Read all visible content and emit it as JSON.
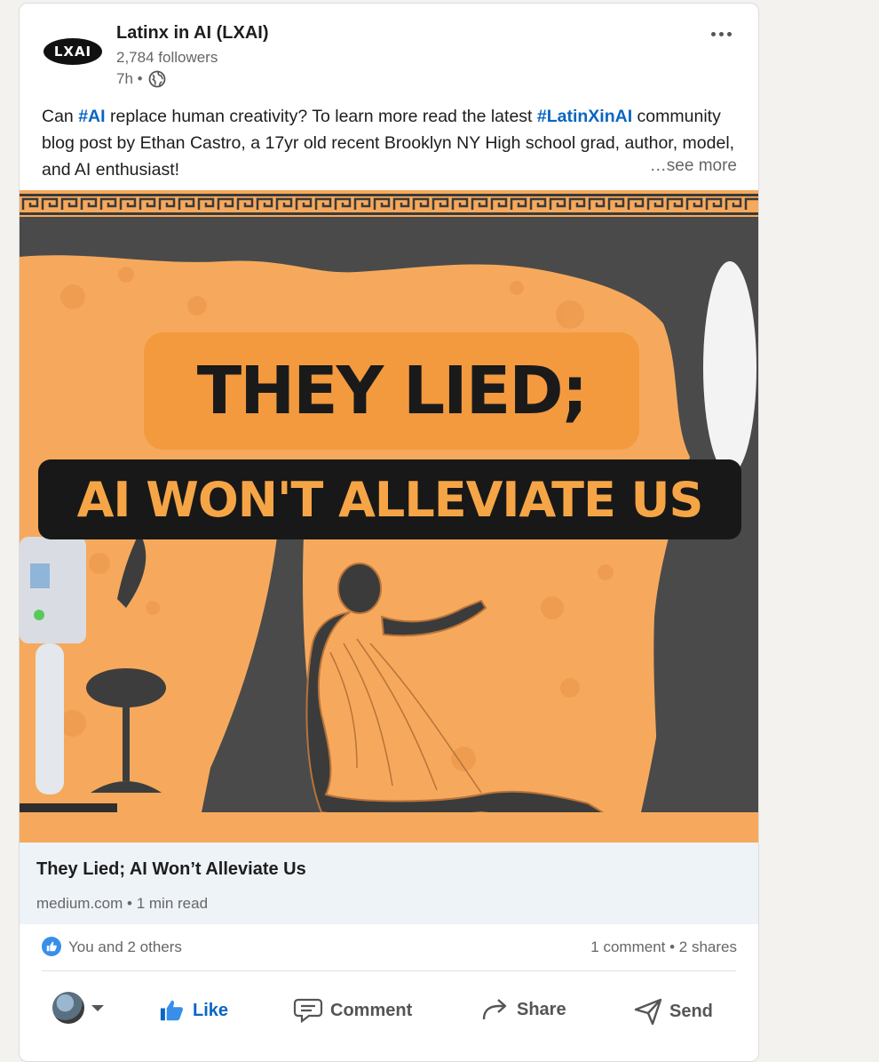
{
  "colors": {
    "link_blue": "#0a66c2",
    "image_orange": "#f6a95c",
    "headline_orange": "#f39a3f",
    "headline_dark": "#181818",
    "preview_bg": "#eef3f8"
  },
  "header": {
    "logo_text": "LXAI",
    "company_name": "Latinx in AI (LXAI)",
    "followers": "2,784 followers",
    "time": "7h •",
    "visibility_icon": "globe-icon",
    "more_icon": "ellipsis-icon"
  },
  "post": {
    "text_1": "Can ",
    "hashtag_1": "#AI",
    "text_2": " replace human creativity? To learn more read the latest ",
    "hashtag_2": "#LatinXinAI",
    "text_3": " community blog post by Ethan Castro, a 17yr old recent Brooklyn NY High school grad, author, model, and AI enthusiast!",
    "see_more": "…see more"
  },
  "image": {
    "headline_top": "THEY LIED;",
    "headline_bottom": "AI WON'T ALLEVIATE US"
  },
  "link_preview": {
    "title": "They Lied; AI Won’t Alleviate Us",
    "meta": "medium.com • 1 min read"
  },
  "social": {
    "reaction_icon": "like-reaction-icon",
    "reactions": "You and 2 others",
    "comments": "1 comment",
    "separator": " • ",
    "shares": "2 shares"
  },
  "actions": {
    "like": "Like",
    "comment": "Comment",
    "share": "Share",
    "send": "Send"
  }
}
